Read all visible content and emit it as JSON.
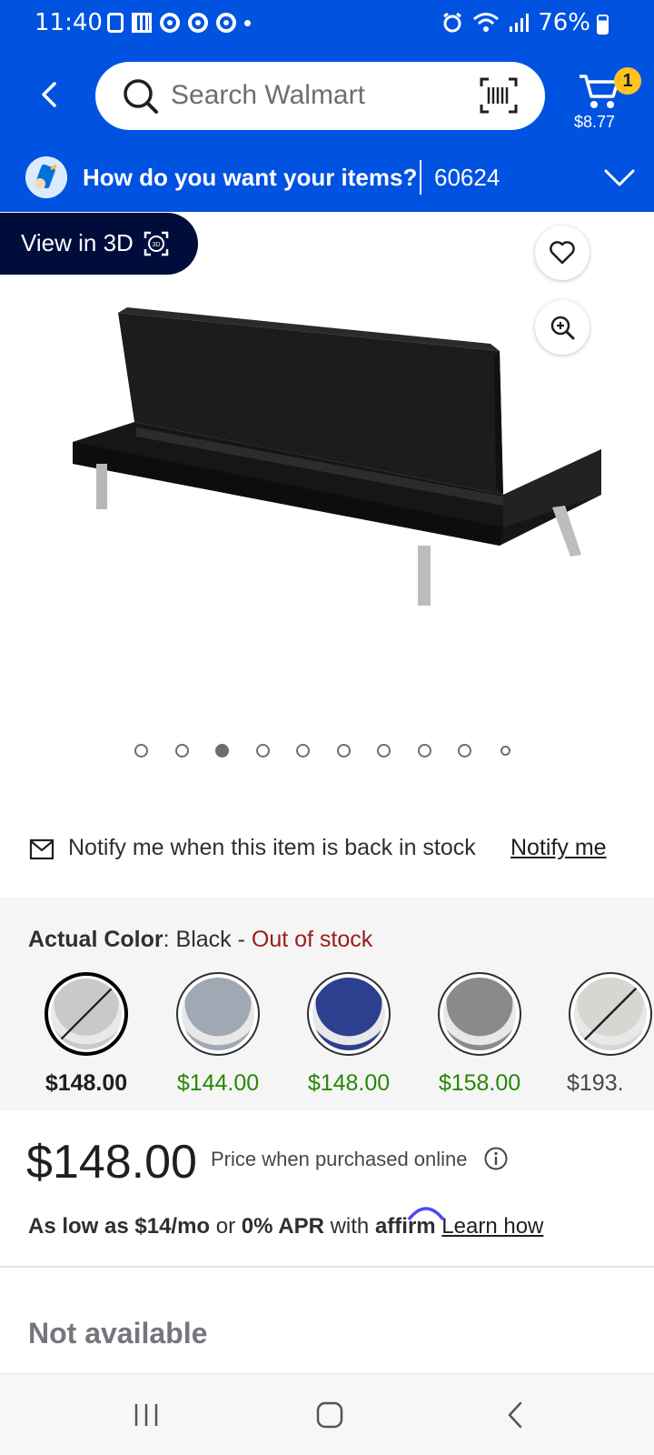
{
  "status_bar": {
    "time": "11:40",
    "battery": "76%"
  },
  "search": {
    "placeholder": "Search Walmart"
  },
  "cart": {
    "count": "1",
    "total": "$8.77"
  },
  "fulfillment": {
    "prompt": "How do you want your items?",
    "zip": "60624"
  },
  "product": {
    "view3d_label": "View in 3D",
    "image_index": 3,
    "image_count": 10
  },
  "notify": {
    "text": "Notify me when this item is back in stock",
    "link": "Notify me"
  },
  "variants": {
    "label": "Actual Color",
    "selected_value": "Black",
    "separator": " - ",
    "stock_status": "Out of stock",
    "options": [
      {
        "price": "$148.00",
        "color": "#c9c9c9",
        "selected": true,
        "out_of_stock": true
      },
      {
        "price": "$144.00",
        "color": "#9fa8b3",
        "selected": false,
        "out_of_stock": false
      },
      {
        "price": "$148.00",
        "color": "#2d3f8f",
        "selected": false,
        "out_of_stock": false
      },
      {
        "price": "$158.00",
        "color": "#8a8a8a",
        "selected": false,
        "out_of_stock": false
      },
      {
        "price": "$193.",
        "color": "#d8d6d2",
        "selected": false,
        "out_of_stock": true
      }
    ]
  },
  "pricing": {
    "price": "$148.00",
    "price_note": "Price when purchased online",
    "financing_prefix": "As low as $14/mo",
    "financing_or": " or ",
    "financing_apr": "0% APR",
    "financing_with": " with ",
    "affirm": "affirm",
    "learn_how": "Learn how"
  },
  "availability": "Not available",
  "colors": {
    "header_blue": "#0052e0",
    "cart_badge": "#ffc220",
    "price_green": "#2a8703",
    "out_of_stock_red": "#9b1c1c",
    "view3d_bg": "#000d3a"
  }
}
